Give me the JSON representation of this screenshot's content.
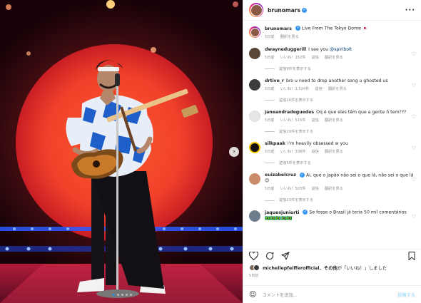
{
  "post": {
    "username": "brunomars",
    "caption": "Live From The Tokyo Dome",
    "caption_emoji": "🇯🇵",
    "time": "5日前",
    "translate": "翻訳を見る"
  },
  "comments": [
    {
      "user": "dwayneduggerill",
      "text": "I see you ",
      "mention": "@spiribolt",
      "time": "5日前",
      "likes": "いいね！152件",
      "reply": "返信",
      "translate": "翻訳を見る",
      "replies": "返信9件を表示する",
      "avatar": "#5b4636"
    },
    {
      "user": "drtive_r",
      "text": "bro u need to drop another song u ghosted us",
      "time": "5日前",
      "likes": "いいね！1,524件",
      "reply": "返信",
      "translate": "翻訳を見る",
      "replies": "返信10件を表示する",
      "avatar": "#3c3c3c"
    },
    {
      "user": "janeandradeguedes",
      "text": "Oq é que eles têm que a gente ñ tem???",
      "time": "5日前",
      "likes": "いいね！515件",
      "reply": "返信",
      "translate": "翻訳を見る",
      "replies": "返信19件を表示する",
      "avatar": "#e6e6e6"
    },
    {
      "user": "silkpaak",
      "text": "i'm heavily obsessed w you",
      "time": "5日前",
      "likes": "いいね！338件",
      "reply": "返信",
      "translate": "翻訳を見る",
      "replies": "返信5件を表示する",
      "avatar": "#111111"
    },
    {
      "user": "euizabelcruz",
      "verified": true,
      "text": "Ai, que o Japão não sei o que lá, não sei o que lá ",
      "emoji": "😊",
      "time": "5日前",
      "likes": "いいね！503件",
      "reply": "返信",
      "translate": "翻訳を見る",
      "replies": "返信23件を表示する",
      "avatar": "#c98b6b"
    },
    {
      "user": "jaquesjuniorti",
      "verified": true,
      "text": "Se fosse o Brasil já teria 50 mil comentários",
      "extra": "🇧🇷🇧🇷🇧🇷🇧🇷🇧🇷",
      "time": "",
      "likes": "",
      "reply": "",
      "translate": "",
      "replies": "",
      "avatar": "#6d7d8c"
    }
  ],
  "liked_by": {
    "name": "michellepfeifferofficial",
    "suffix": "、その他",
    "tail": "が「いいね！」しました"
  },
  "post_date": "5日前",
  "add_comment": {
    "placeholder": "コメントを追加...",
    "post": "投稿する",
    "emoji": "☺"
  },
  "icons": {
    "heart": "heart-icon",
    "comment": "comment-icon",
    "share": "share-icon",
    "save": "bookmark-icon",
    "more": "more-icon"
  },
  "colors": {
    "accent": "#3897f0",
    "link": "#00376b",
    "muted": "#8e8e8e"
  }
}
